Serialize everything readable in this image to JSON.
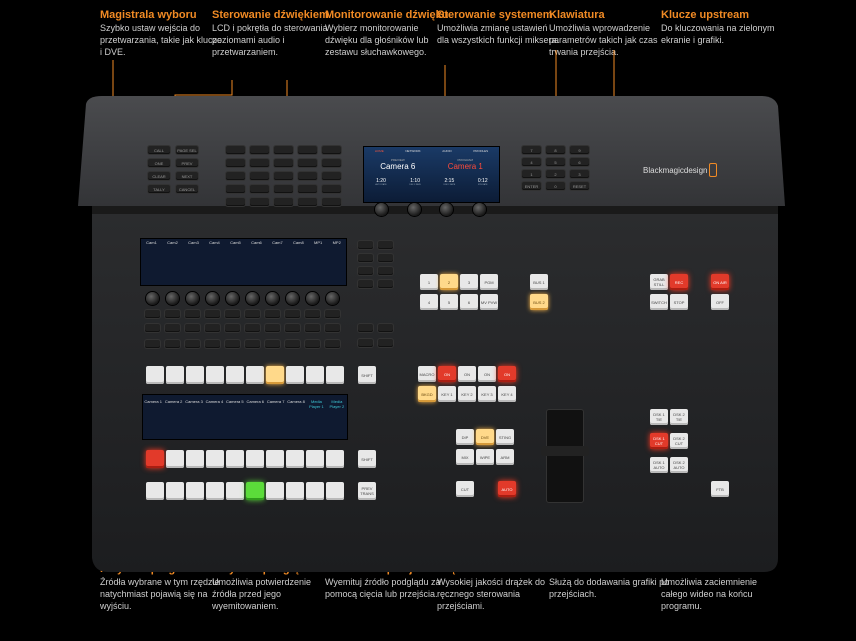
{
  "callouts_top": [
    {
      "title": "Magistrala wyboru",
      "desc": "Szybko ustaw wejścia do przetwarzania, takie jak klucze i DVE."
    },
    {
      "title": "Sterowanie dźwiękiem",
      "desc": "LCD i pokrętła do sterowania poziomami audio i przetwarzaniem."
    },
    {
      "title": "Monitorowanie dźwięku",
      "desc": "Wybierz monitorowanie dźwięku dla głośników lub zestawu słuchawkowego."
    },
    {
      "title": "Sterowanie systemem",
      "desc": "Umożliwia zmianę ustawień dla wszystkich funkcji miksera."
    },
    {
      "title": "Klawiatura",
      "desc": "Umożliwia wprowadzenie parametrów takich jak czas trwania przejścia."
    },
    {
      "title": "Klucze upstream",
      "desc": "Do kluczowania na zielonym ekranie i grafiki."
    }
  ],
  "callouts_bottom": [
    {
      "title": "Przyciski programu",
      "desc": "Źródła wybrane w tym rzędzie natychmiast pojawią się na wyjściu."
    },
    {
      "title": "Przyciski podglądu",
      "desc": "Umożliwia potwierdzenie źródła przed jego wyemitowaniem."
    },
    {
      "title": "Sterowanie przejściami",
      "desc": "Wyemituj źródło podglądu za pomocą cięcia lub przejścia."
    },
    {
      "title": "Drążek t-bar",
      "desc": "Wysokiej jakości drążek do ręcznego sterowania przejściami."
    },
    {
      "title": "Klucze downstream",
      "desc": "Służą do dodawania grafiki po przejściach."
    },
    {
      "title": "Zaciemnianie",
      "desc": "Umożliwia zaciemnienie całego wideo na końcu programu."
    }
  ],
  "device": {
    "brand": "Blackmagicdesign",
    "lcd_tabs": [
      "HOME",
      "NETWORK",
      "AUDIO",
      "PROFILES"
    ],
    "lcd_preview_label": "PREVIEW",
    "lcd_program_label": "PROGRAM",
    "lcd_preview": "Camera 6",
    "lcd_program": "Camera 1",
    "lcd_values": [
      "1:20",
      "1:10",
      "2:15",
      "0:12"
    ],
    "lcd_value_labels": [
      "AUTO RATE",
      "DSK 1 RATE",
      "DSK 2 RATE",
      "FTB RATE"
    ],
    "audio_channels": [
      "Cam1",
      "Cam2",
      "Cam3",
      "Cam4",
      "Cam5",
      "Cam6",
      "Cam7",
      "Cam8",
      "MP1",
      "MP2"
    ],
    "source_names": [
      "Camera 1",
      "Camera 2",
      "Camera 3",
      "Camera 4",
      "Camera 5",
      "Camera 6",
      "Camera 7",
      "Camera 8",
      "Media Player 1",
      "Media Player 2"
    ],
    "shift": "SHIFT",
    "prev_trans": "PREV TRANS",
    "bus_keys": [
      "BUS 1",
      "BUS 2"
    ],
    "key_labels": [
      "MACRO",
      "ON",
      "ON",
      "ON",
      "ON",
      "BKGD",
      "KEY 1",
      "KEY 2",
      "KEY 3",
      "KEY 4"
    ],
    "trans_labels": [
      "DIP",
      "DVE",
      "STING",
      "MIX",
      "WIPE",
      "ARM",
      "CUT",
      "AUTO"
    ],
    "dsk_labels": [
      "DSK 1 TIE",
      "DSK 2 TIE",
      "DSK 1 CUT",
      "DSK 2 CUT",
      "DSK 1 AUTO",
      "DSK 2 AUTO",
      "FTB"
    ],
    "still_labels": [
      "GRAB STILL",
      "REC",
      "SWITCH",
      "STOP",
      "ON AIR",
      "OFF"
    ],
    "num_keys": [
      "1",
      "2",
      "3",
      "PGM",
      "4",
      "5",
      "6",
      "MV PVW"
    ],
    "left_keys": [
      "CALL",
      "PAGE SEL",
      "ONE",
      "PREV",
      "CLEAR",
      "NEXT",
      "TALLY",
      "CANCEL"
    ],
    "keypad_keys": [
      "7",
      "8",
      "9",
      "4",
      "5",
      "6",
      "1",
      "2",
      "3",
      "ENTER",
      "0",
      "RESET"
    ]
  }
}
